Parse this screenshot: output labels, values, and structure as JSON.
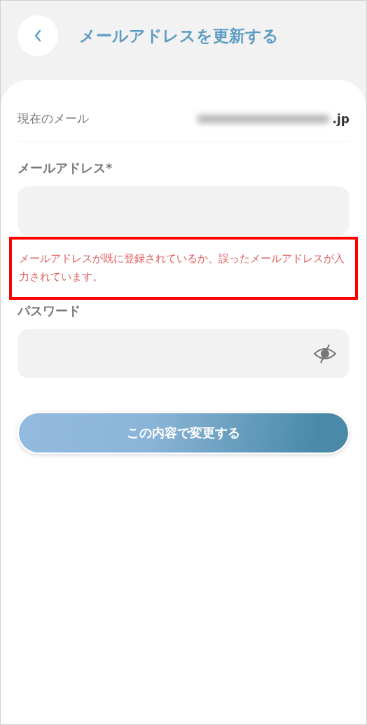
{
  "header": {
    "title": "メールアドレスを更新する"
  },
  "current_email": {
    "label": "現在のメール",
    "value_suffix": ".jp",
    "blurred": true
  },
  "email_field": {
    "label": "メールアドレス*",
    "error": "メールアドレスが既に登録されているか、誤ったメールアドレスが入力されています。",
    "error_highlighted": true
  },
  "password_field": {
    "label": "パスワード",
    "password_visible": false
  },
  "submit_button": {
    "label": "この内容で変更する"
  }
}
